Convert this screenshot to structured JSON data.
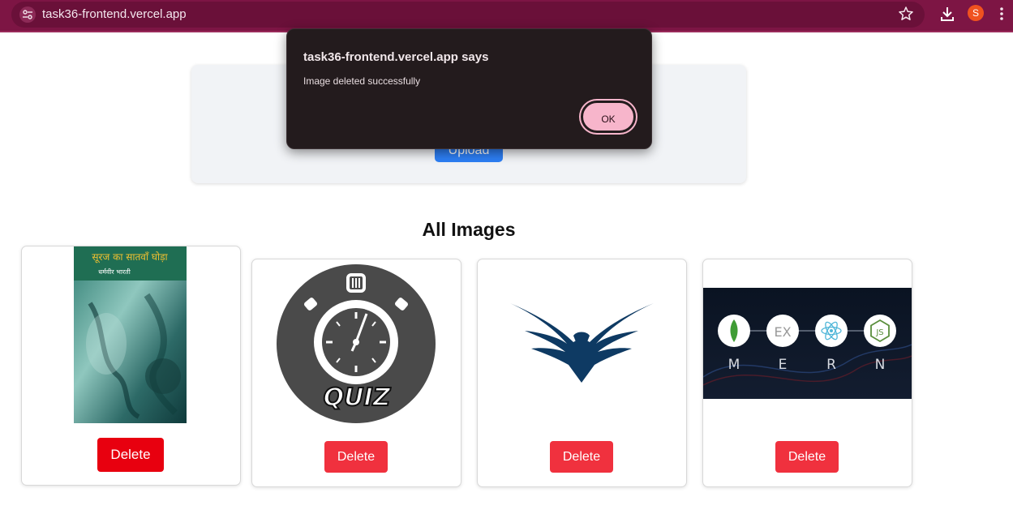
{
  "browser": {
    "url": "task36-frontend.vercel.app",
    "profile_initial": "S",
    "icons": [
      "tune-icon",
      "star-icon",
      "download-icon",
      "kebab-menu-icon"
    ]
  },
  "upload": {
    "button_label": "Upload"
  },
  "gallery": {
    "title": "All Images",
    "cards": [
      {
        "image": "book-cover",
        "book_title": "सूरज का सातवाँ घोड़ा",
        "book_author": "धर्मवीर भारती",
        "delete_label": "Delete"
      },
      {
        "image": "quiz-stopwatch",
        "caption": "QUIZ",
        "delete_label": "Delete"
      },
      {
        "image": "eagle-logo",
        "delete_label": "Delete"
      },
      {
        "image": "mern-banner",
        "letters": [
          "M",
          "E",
          "R",
          "N"
        ],
        "ex_text": "EX",
        "js_text": "JS",
        "delete_label": "Delete"
      }
    ]
  },
  "dialog": {
    "title": "task36-frontend.vercel.app says",
    "message": "Image deleted successfully",
    "ok_label": "OK"
  },
  "colors": {
    "browser_bar": "#7d1544",
    "delete": "#f0313e",
    "upload": "#2d7ff5",
    "dialog_bg": "#231b1d",
    "ok_bg": "#f7b5cb"
  }
}
